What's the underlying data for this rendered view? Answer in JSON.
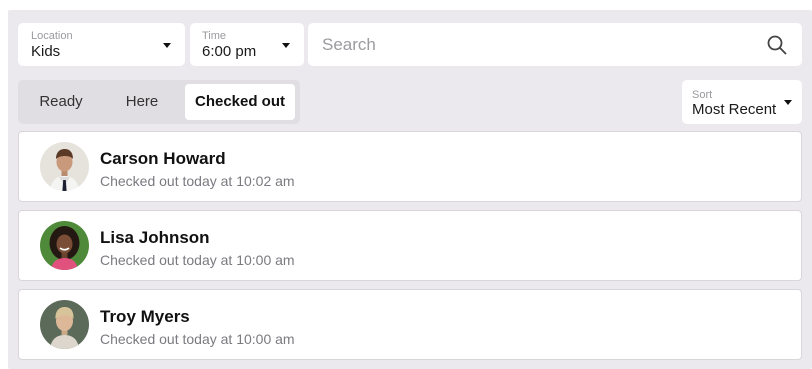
{
  "filters": {
    "location": {
      "label": "Location",
      "value": "Kids"
    },
    "time": {
      "label": "Time",
      "value": "6:00 pm"
    },
    "search": {
      "placeholder": "Search"
    }
  },
  "tabs": [
    {
      "label": "Ready",
      "active": false
    },
    {
      "label": "Here",
      "active": false
    },
    {
      "label": "Checked out",
      "active": true
    }
  ],
  "sort": {
    "label": "Sort",
    "value": "Most Recent"
  },
  "people": [
    {
      "name": "Carson Howard",
      "status": "Checked out today at 10:02 am",
      "avatar": "child-photo-boy-suit"
    },
    {
      "name": "Lisa Johnson",
      "status": "Checked out today at 10:00 am",
      "avatar": "child-photo-girl"
    },
    {
      "name": "Troy Myers",
      "status": "Checked out today at 10:00 am",
      "avatar": "child-photo-boy-blond"
    }
  ],
  "icons": {
    "dropdown": "caret-down-icon",
    "search": "search-icon"
  },
  "colors": {
    "background": "#ebe9ee",
    "card": "#ffffff",
    "segment_track": "#e0dee3",
    "secondary_text": "#7a7a80",
    "placeholder_text": "#9b9ba0"
  }
}
